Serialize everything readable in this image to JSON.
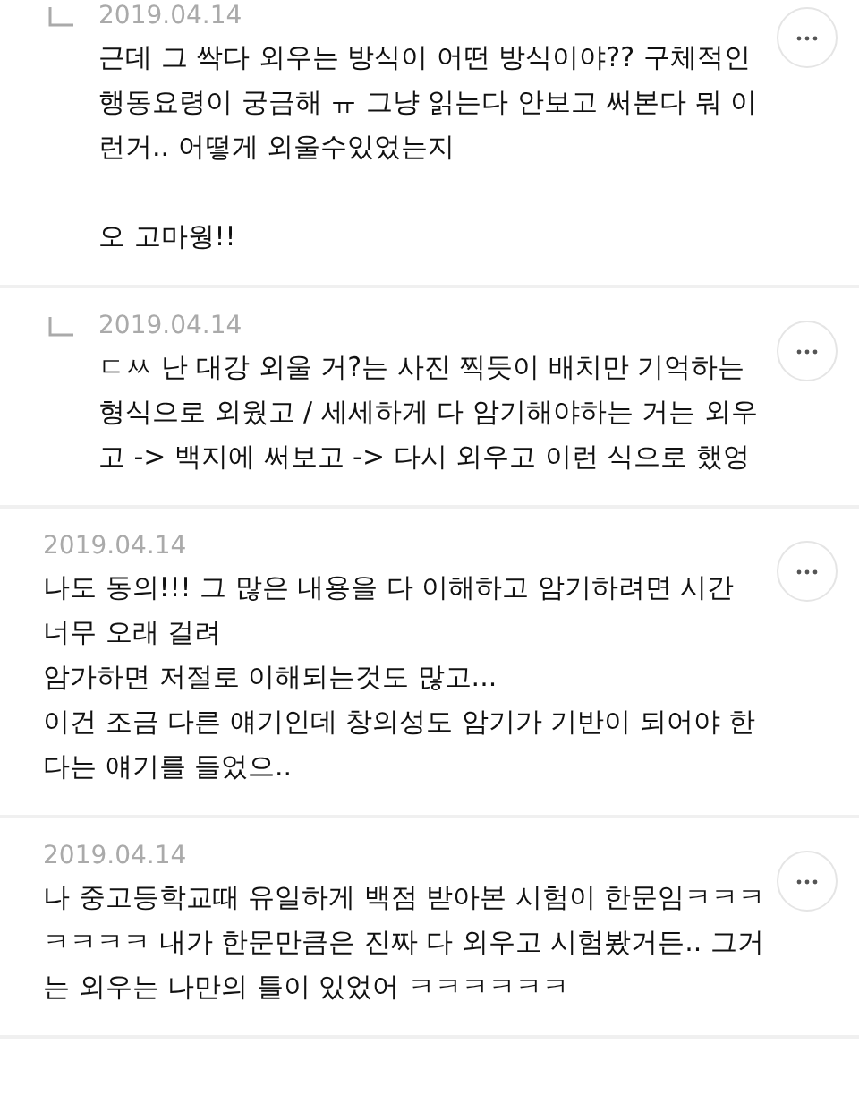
{
  "comments": [
    {
      "reply": true,
      "date": "2019.04.14",
      "body": "근데 그 싹다 외우는 방식이 어떤 방식이야?? 구체적인 행동요령이 궁금해 ㅠ 그냥 읽는다 안보고 써본다 뭐 이런거.. 어떻게 외울수있었는지\n\n오 고마웡!!"
    },
    {
      "reply": true,
      "date": "2019.04.14",
      "body": "ㄷㅆ 난 대강 외울 거?는 사진 찍듯이 배치만 기억하는 형식으로 외웠고 / 세세하게 다 암기해야하는 거는 외우고 -> 백지에 써보고 -> 다시 외우고 이런 식으로 했엉"
    },
    {
      "reply": false,
      "date": "2019.04.14",
      "body": "나도 동의!!! 그 많은 내용을 다 이해하고 암기하려면 시간 너무 오래 걸려\n암가하면 저절로 이해되는것도 많고...\n이건 조금 다른 얘기인데 창의성도 암기가 기반이 되어야 한다는 얘기를 들었으.."
    },
    {
      "reply": false,
      "date": "2019.04.14",
      "body": "나 중고등학교때 유일하게 백점 받아본 시험이 한문임ㅋㅋㅋㅋㅋㅋㅋ 내가 한문만큼은 진짜 다 외우고 시험봤거든.. 그거는 외우는 나만의 틀이 있었어 ㅋㅋㅋㅋㅋㅋ"
    }
  ]
}
